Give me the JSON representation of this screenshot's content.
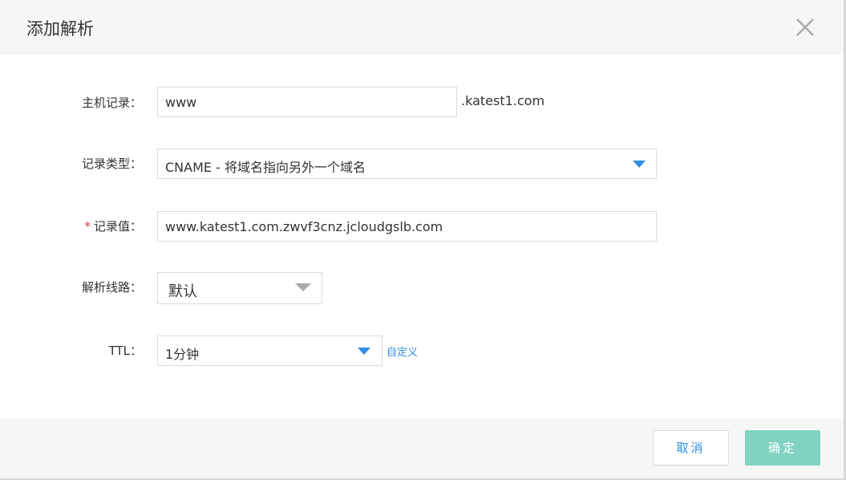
{
  "dialog": {
    "title": "添加解析",
    "close_icon": "close-icon"
  },
  "form": {
    "host_record": {
      "label": "主机记录：",
      "value": "www",
      "suffix": ".katest1.com"
    },
    "record_type": {
      "label": "记录类型：",
      "value": "CNAME - 将域名指向另外一个域名"
    },
    "record_value": {
      "required_mark": "*",
      "label": "记录值：",
      "value": "www.katest1.com.zwvf3cnz.jcloudgslb.com"
    },
    "line": {
      "label": "解析线路：",
      "value": "默认"
    },
    "ttl": {
      "label": "TTL：",
      "value": "1分钟",
      "custom_link": "自定义"
    }
  },
  "footer": {
    "cancel_label": "取消",
    "ok_label": "确定"
  },
  "colors": {
    "accent": "#2f8ee6",
    "ok_button": "#7fd3c0",
    "header_bg": "#f6f6f6"
  }
}
